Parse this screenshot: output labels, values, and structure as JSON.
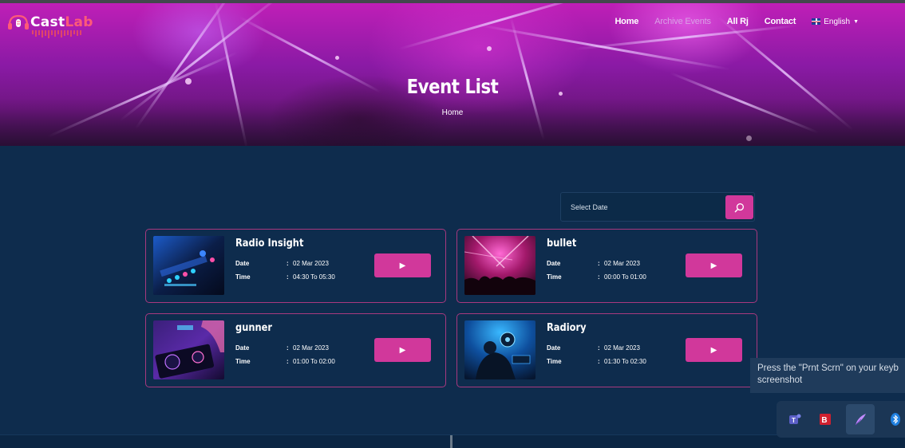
{
  "brand": {
    "part1": "Cast",
    "part2": "Lab"
  },
  "nav": {
    "items": [
      {
        "label": "Home",
        "active": false
      },
      {
        "label": "Archive Events",
        "active": true
      },
      {
        "label": "All Rj",
        "active": false
      },
      {
        "label": "Contact",
        "active": false
      }
    ],
    "language": "English"
  },
  "hero": {
    "title": "Event List",
    "breadcrumb": "Home"
  },
  "search": {
    "placeholder": "Select Date"
  },
  "labels": {
    "date": "Date",
    "time": "Time",
    "colon": ":"
  },
  "events": [
    {
      "title": "Radio Insight",
      "date": "02 Mar 2023",
      "time": "04:30 To 05:30",
      "thumb": "dj-mixer-blue"
    },
    {
      "title": "bullet",
      "date": "02 Mar 2023",
      "time": "00:00 To 01:00",
      "thumb": "concert-crowd-pink"
    },
    {
      "title": "gunner",
      "date": "02 Mar 2023",
      "time": "01:00 To 02:00",
      "thumb": "dj-hands-purple"
    },
    {
      "title": "Radiory",
      "date": "02 Mar 2023",
      "time": "01:30 To 02:30",
      "thumb": "dj-performer-blue"
    }
  ],
  "toast": {
    "line1": "Press the \"Prnt Scrn\" on your keyb",
    "line2": "screenshot"
  },
  "tray": {
    "icons": [
      "teams-icon",
      "pdf-icon",
      "feather-pen-icon",
      "bluetooth-icon"
    ]
  },
  "colors": {
    "accent": "#d1389b",
    "background": "#0e2c4d",
    "card_border": "#a8397f"
  }
}
